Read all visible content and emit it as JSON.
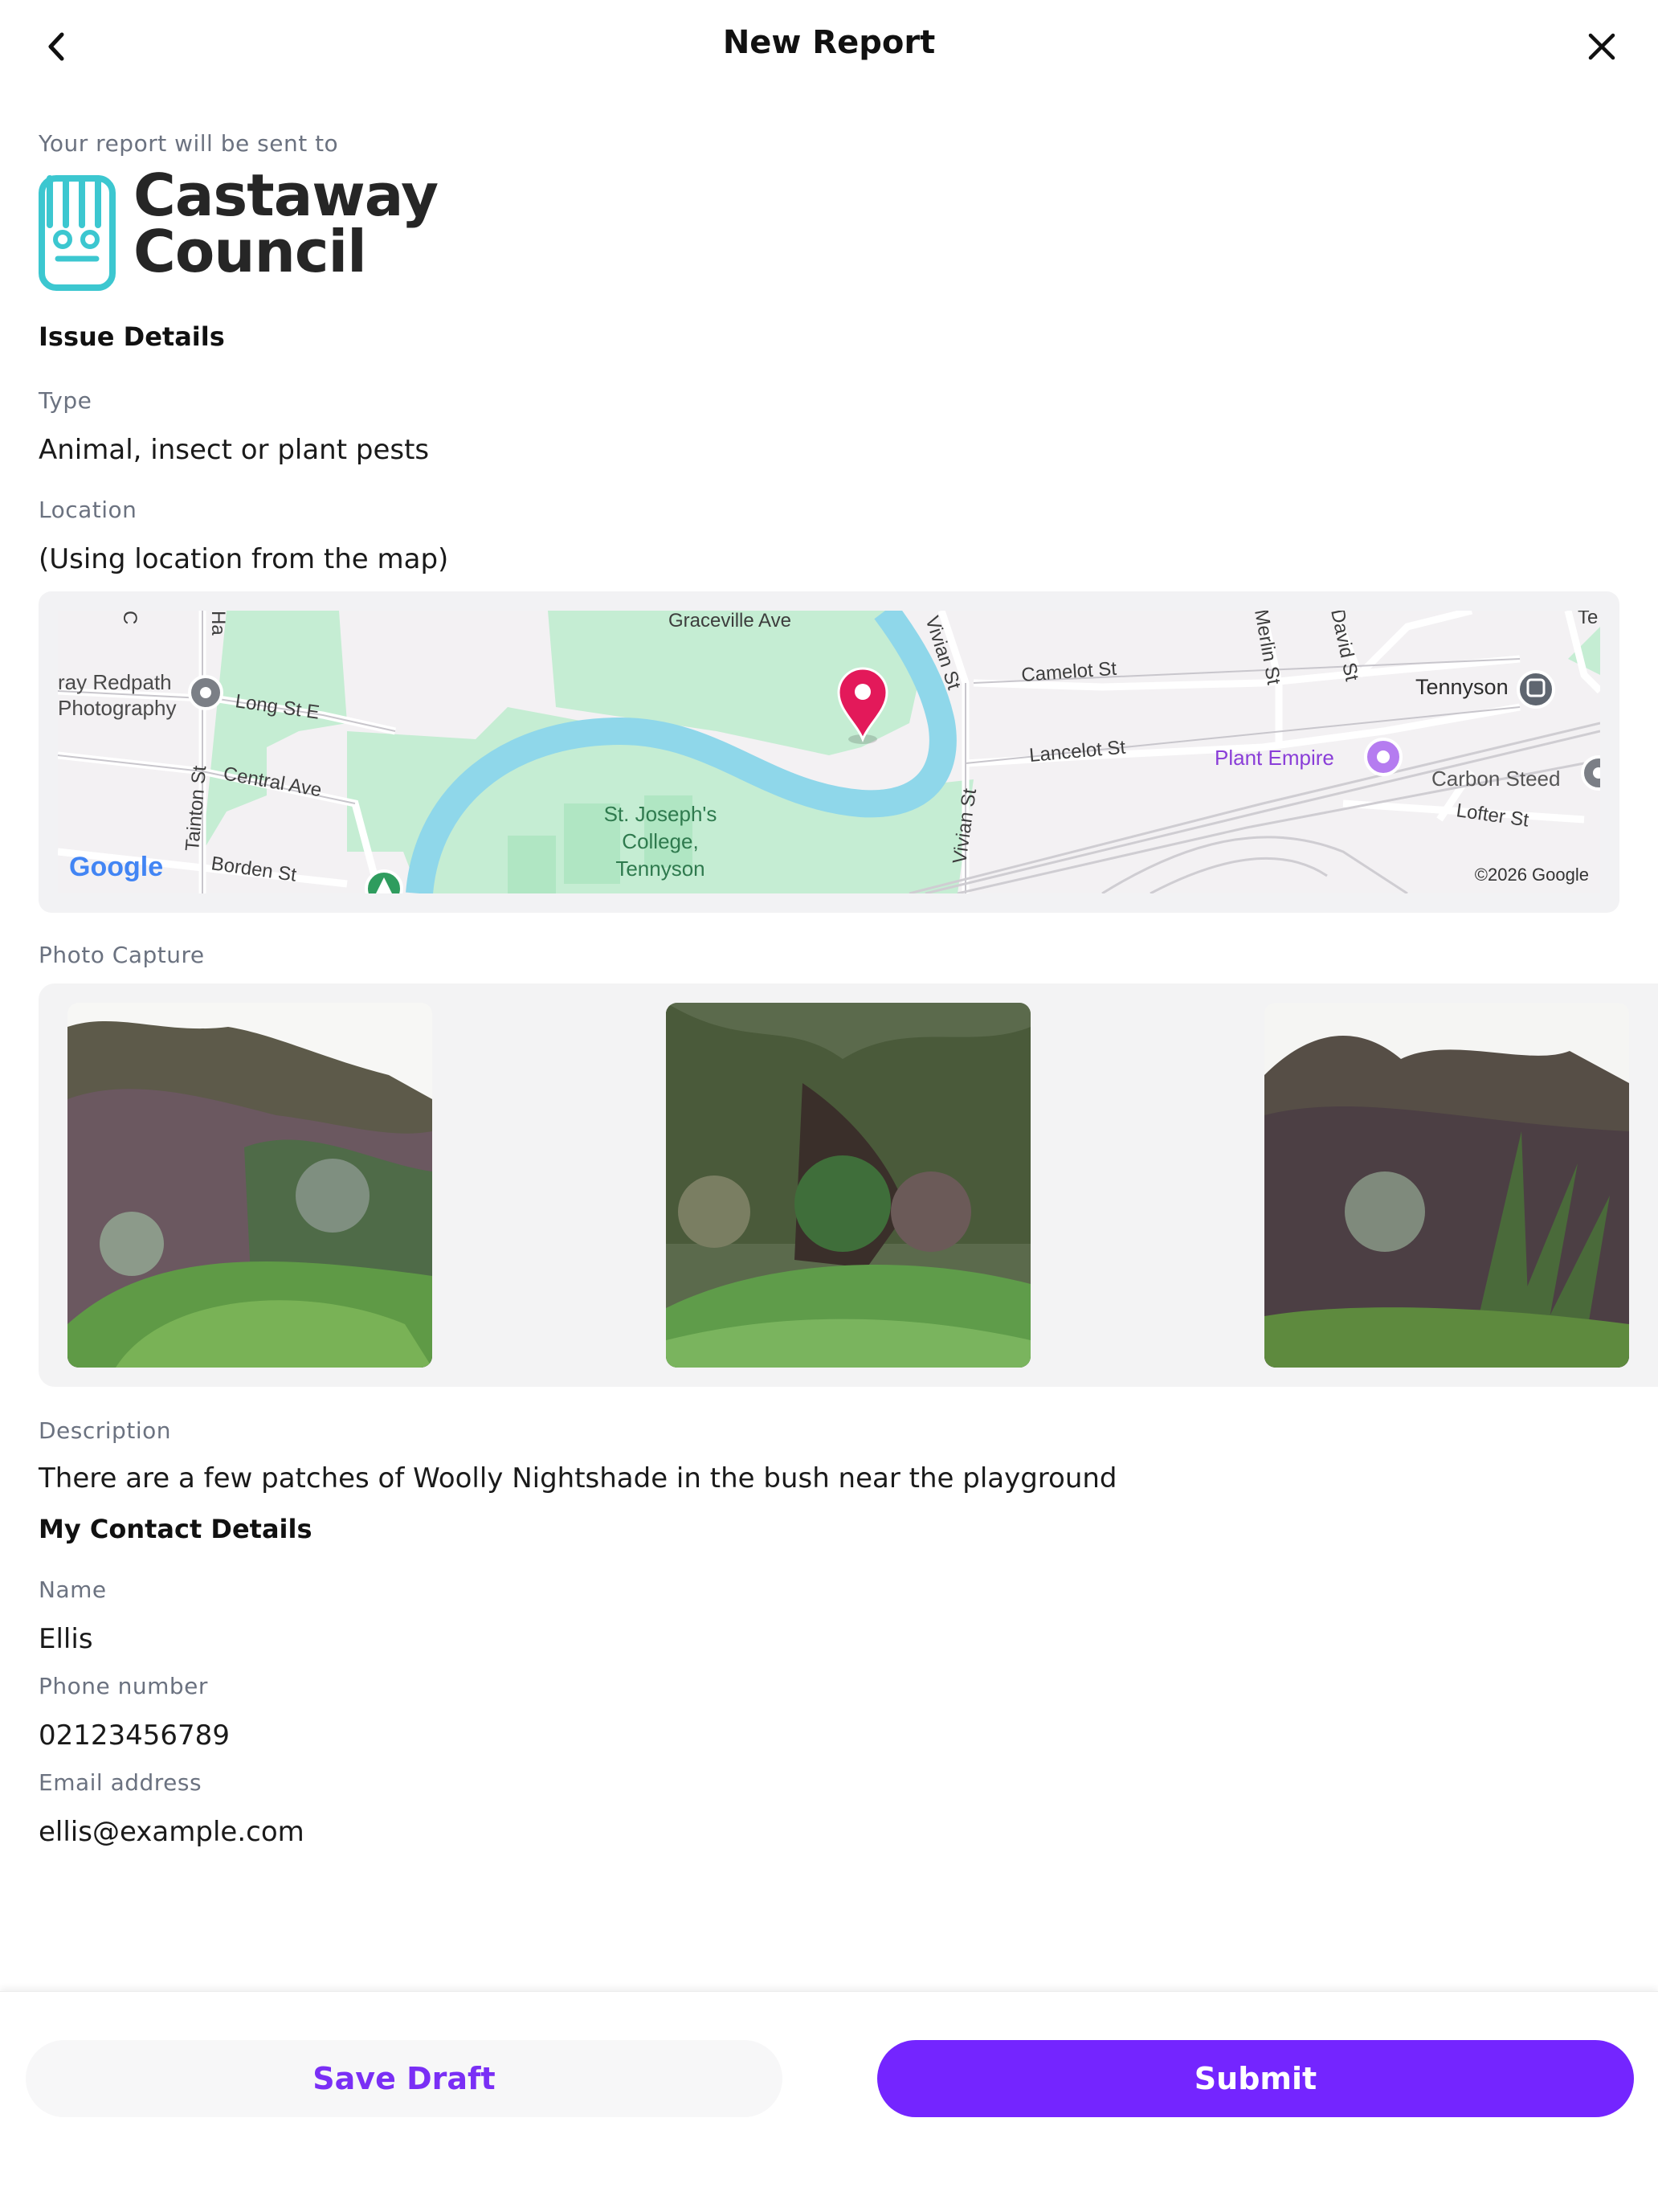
{
  "header": {
    "title": "New Report"
  },
  "recipient": {
    "label": "Your report will be sent to",
    "council_line1": "Castaway",
    "council_line2": "Council"
  },
  "issue": {
    "section_title": "Issue Details",
    "type_label": "Type",
    "type_value": "Animal, insect or plant pests",
    "location_label": "Location",
    "location_value": "(Using location from the map)"
  },
  "map": {
    "streets": {
      "graceville": "Graceville Ave",
      "vivian1": "Vivian St",
      "vivian2": "Vivian St",
      "camelot": "Camelot St",
      "merlin": "Merlin St",
      "david": "David St",
      "lancelot": "Lancelot St",
      "long": "Long St E",
      "central": "Central Ave",
      "tainton": "Tainton St",
      "borden": "Borden St",
      "lofter": "Lofter St",
      "c": "C",
      "ha": "Ha",
      "te": "Te"
    },
    "places": {
      "redpath1": "ray Redpath",
      "redpath2": "Photography",
      "tennyson": "Tennyson",
      "plant_empire": "Plant Empire",
      "carbon_steed": "Carbon Steed",
      "college1": "St. Joseph's",
      "college2": "College,",
      "college3": "Tennyson"
    },
    "google_logo": "Google",
    "copyright": "©2026 Google",
    "pin_color": "#e3195a"
  },
  "photos": {
    "label": "Photo Capture",
    "items": [
      "photo-1",
      "photo-2",
      "photo-3"
    ]
  },
  "description": {
    "label": "Description",
    "value": "There are a few patches of Woolly Nightshade in the bush near the playground"
  },
  "contact": {
    "section_title": "My Contact Details",
    "name_label": "Name",
    "name_value": "Ellis",
    "phone_label": "Phone number",
    "phone_value": "02123456789",
    "email_label": "Email address",
    "email_value": "ellis@example.com"
  },
  "footer": {
    "save_draft_label": "Save Draft",
    "submit_label": "Submit"
  },
  "colors": {
    "accent": "#7425ff",
    "logo": "#3cc7d0"
  }
}
